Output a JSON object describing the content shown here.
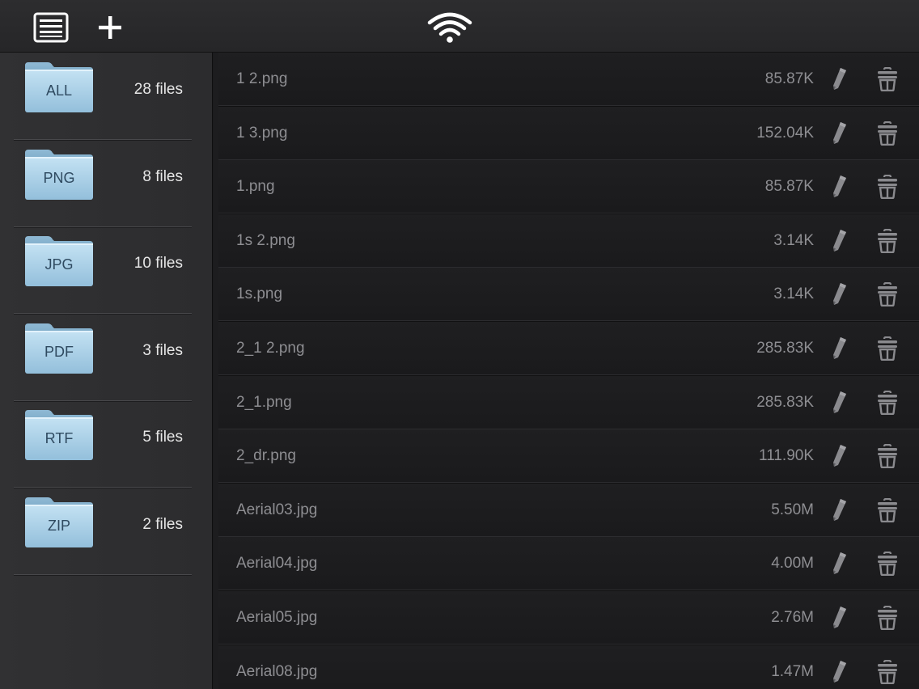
{
  "colors": {
    "folder_blue": "#a9cfe6",
    "icon_gray": "#8a8a8e",
    "text_white": "#e6e6e6",
    "text_gray": "#8e8e92"
  },
  "toolbar": {
    "menu_icon": "list-menu-icon",
    "add_icon": "plus-icon",
    "wifi_icon": "wifi-icon"
  },
  "categories": [
    {
      "label": "ALL",
      "count": "28 files"
    },
    {
      "label": "PNG",
      "count": "8 files"
    },
    {
      "label": "JPG",
      "count": "10 files"
    },
    {
      "label": "PDF",
      "count": "3 files"
    },
    {
      "label": "RTF",
      "count": "5 files"
    },
    {
      "label": "ZIP",
      "count": "2 files"
    }
  ],
  "files": [
    {
      "name": "1 2.png",
      "size": "85.87K"
    },
    {
      "name": "1 3.png",
      "size": "152.04K"
    },
    {
      "name": "1.png",
      "size": "85.87K"
    },
    {
      "name": "1s 2.png",
      "size": "3.14K"
    },
    {
      "name": "1s.png",
      "size": "3.14K"
    },
    {
      "name": "2_1 2.png",
      "size": "285.83K"
    },
    {
      "name": "2_1.png",
      "size": "285.83K"
    },
    {
      "name": "2_dr.png",
      "size": "111.90K"
    },
    {
      "name": "Aerial03.jpg",
      "size": "5.50M"
    },
    {
      "name": "Aerial04.jpg",
      "size": "4.00M"
    },
    {
      "name": "Aerial05.jpg",
      "size": "2.76M"
    },
    {
      "name": "Aerial08.jpg",
      "size": "1.47M"
    }
  ]
}
